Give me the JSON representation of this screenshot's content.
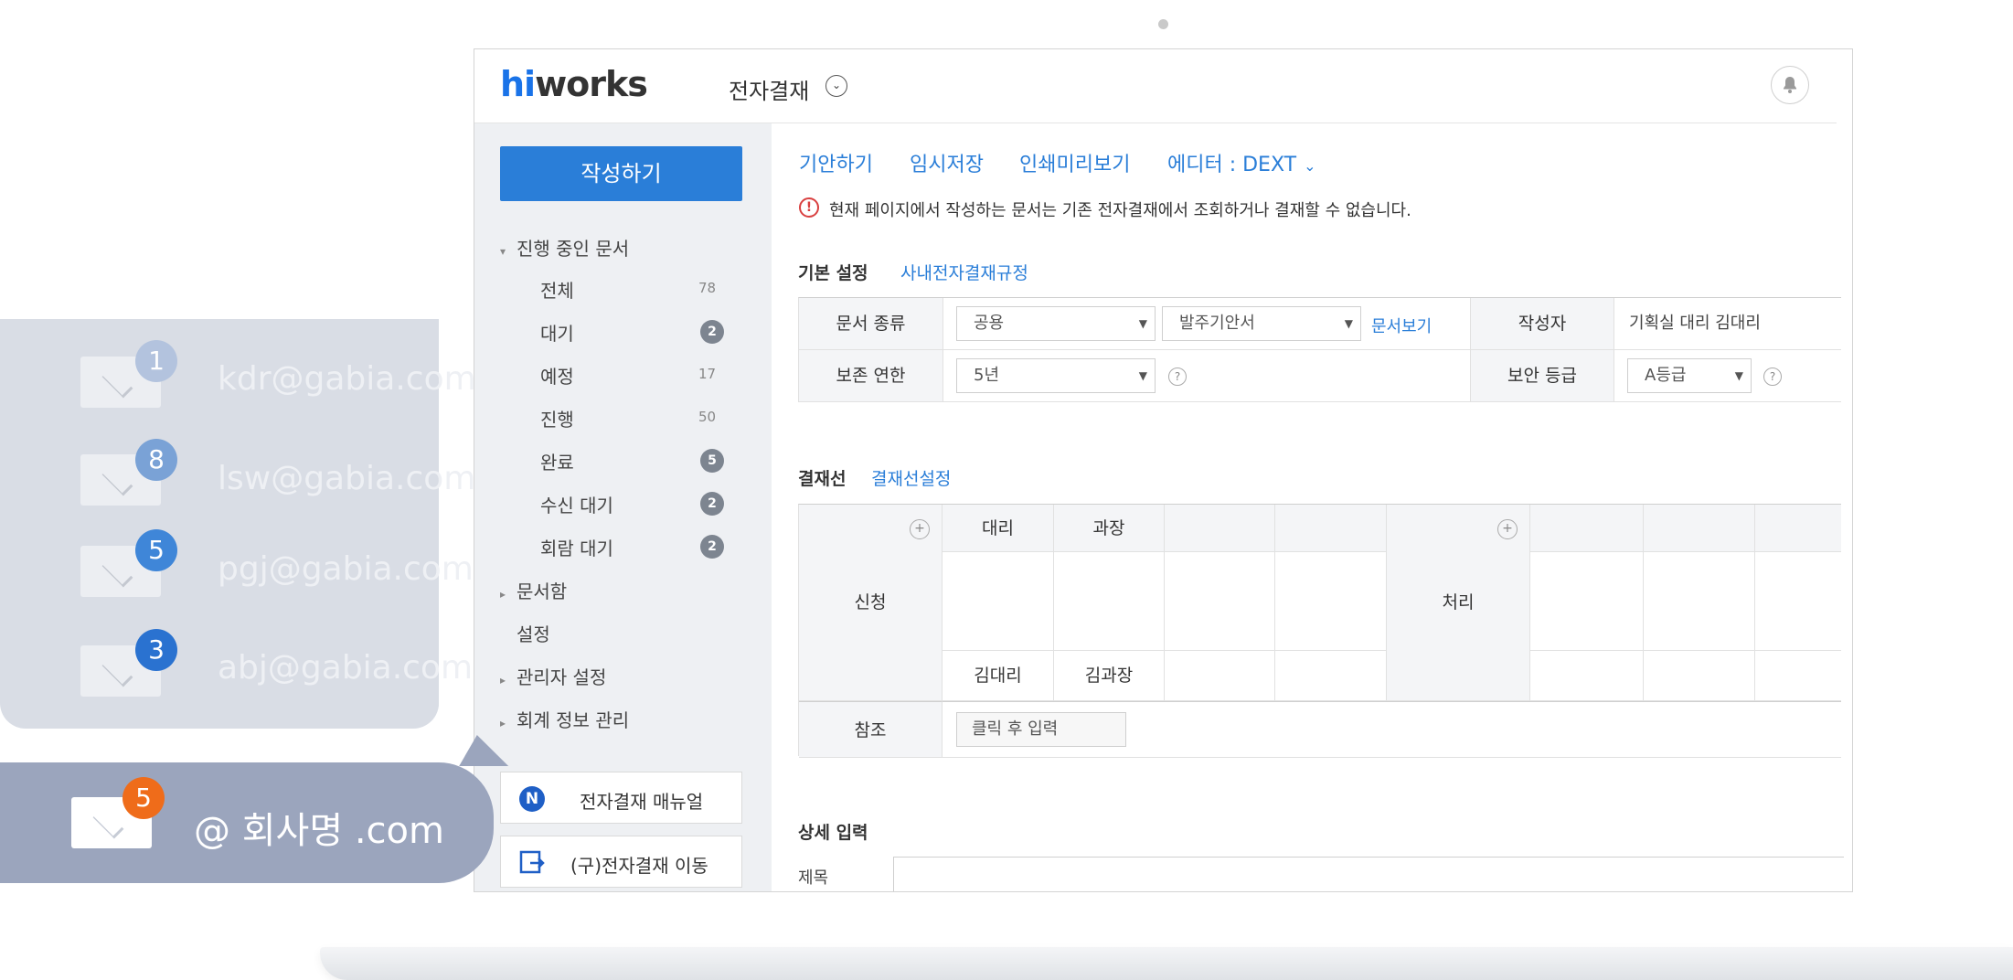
{
  "header": {
    "logo_hi": "hi",
    "logo_rest": "works",
    "app_title": "전자결재",
    "chevron_glyph": "⌄",
    "bell_glyph": "🔔"
  },
  "sidebar": {
    "write_button": "작성하기",
    "in_progress": {
      "label": "진행 중인 문서",
      "items": [
        {
          "label": "전체",
          "count": "78"
        },
        {
          "label": "대기",
          "badge": "2"
        },
        {
          "label": "예정",
          "count": "17"
        },
        {
          "label": "진행",
          "count": "50"
        },
        {
          "label": "완료",
          "badge": "5"
        },
        {
          "label": "수신 대기",
          "badge": "2"
        },
        {
          "label": "회람 대기",
          "badge": "2"
        }
      ]
    },
    "doc_box": "문서함",
    "settings": "설정",
    "admin_settings": "관리자 설정",
    "accounting": "회계 정보 관리",
    "manual_button": "전자결재 매뉴얼",
    "manual_icon_letter": "N",
    "old_approval_button": "(구)전자결재 이동"
  },
  "toolbar": {
    "draft": "기안하기",
    "temp_save": "임시저장",
    "print_preview": "인쇄미리보기",
    "editor": "에디터 : DEXT"
  },
  "warning": {
    "icon": "!",
    "text": "현재 페이지에서 작성하는 문서는 기존 전자결재에서 조회하거나 결재할 수 없습니다."
  },
  "basic_settings": {
    "title": "기본 설정",
    "rules_link": "사내전자결재규정",
    "doc_type_label": "문서 종류",
    "doc_type_value": "공용",
    "doc_form_value": "발주기안서",
    "view_doc_link": "문서보기",
    "author_label": "작성자",
    "author_value": "기획실 대리 김대리",
    "retention_label": "보존 연한",
    "retention_value": "5년",
    "security_label": "보안 등급",
    "security_value": "A등급"
  },
  "approval_line": {
    "title": "결재선",
    "settings_link": "결재선설정",
    "request_label": "신청",
    "process_label": "처리",
    "positions": [
      "대리",
      "과장"
    ],
    "names": [
      "김대리",
      "김과장"
    ],
    "reference_label": "참조",
    "reference_placeholder": "클릭 후 입력"
  },
  "details": {
    "title": "상세 입력",
    "subject_label": "제목"
  },
  "mail_card": {
    "items": [
      {
        "email": "kdr@gabia.com",
        "badge": "1",
        "badge_color": "#b3c3de"
      },
      {
        "email": "lsw@gabia.com",
        "badge": "8",
        "badge_color": "#7aa2d6"
      },
      {
        "email": "pgj@gabia.com",
        "badge": "5",
        "badge_color": "#3f86d8"
      },
      {
        "email": "abj@gabia.com",
        "badge": "3",
        "badge_color": "#2a72d0"
      }
    ]
  },
  "bubble": {
    "badge": "5",
    "text": "@ 회사명 .com"
  },
  "colors": {
    "accent": "#2a7ed8",
    "sidebar_bg": "#eef0f3",
    "warning": "#d94040",
    "bubble": "#9ba5bd",
    "bubble_badge": "#ef6c1a"
  }
}
